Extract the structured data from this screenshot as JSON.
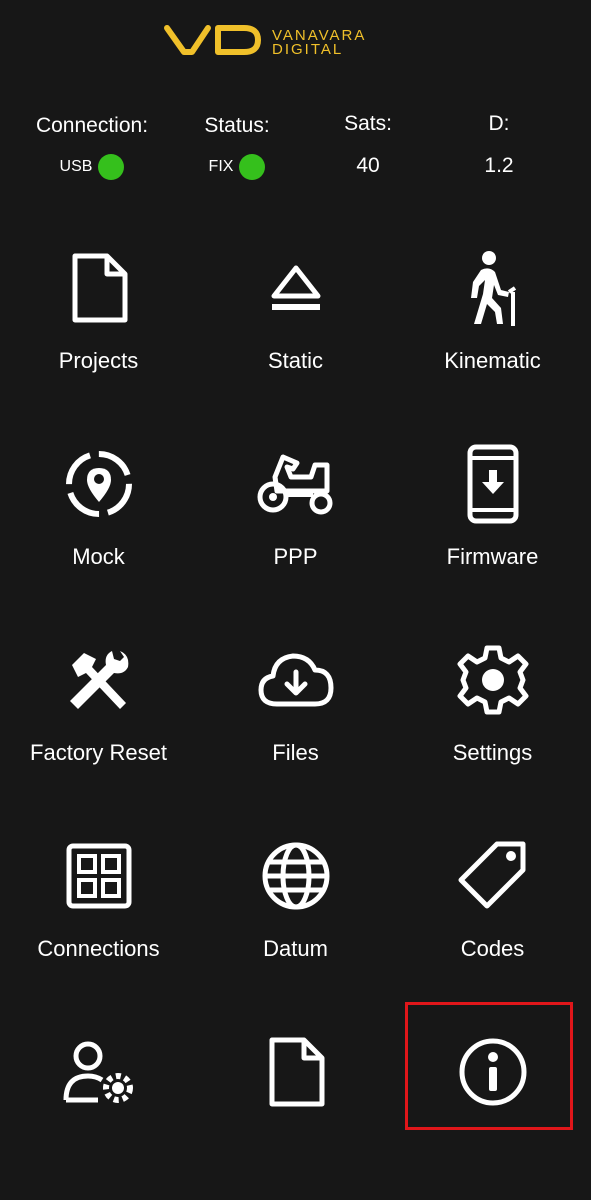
{
  "brand": {
    "line1": "VANAVARA",
    "line2": "DIGITAL",
    "accent_color": "#f0c02a"
  },
  "status_bar": {
    "connection": {
      "label": "Connection:",
      "value": "USB",
      "indicator_color": "#35c01c"
    },
    "status": {
      "label": "Status:",
      "value": "FIX",
      "indicator_color": "#35c01c"
    },
    "sats": {
      "label": "Sats:",
      "value": "40"
    },
    "d": {
      "label": "D:",
      "value": "1.2"
    }
  },
  "menu": [
    {
      "label": "Projects",
      "icon": "document-icon"
    },
    {
      "label": "Static",
      "icon": "eject-icon"
    },
    {
      "label": "Kinematic",
      "icon": "walking-person-icon"
    },
    {
      "label": "Mock",
      "icon": "location-dashed-icon"
    },
    {
      "label": "PPP",
      "icon": "tractor-icon"
    },
    {
      "label": "Firmware",
      "icon": "phone-download-icon"
    },
    {
      "label": "Factory Reset",
      "icon": "tools-icon"
    },
    {
      "label": "Files",
      "icon": "cloud-download-icon"
    },
    {
      "label": "Settings",
      "icon": "gear-icon"
    },
    {
      "label": "Connections",
      "icon": "grid-icon"
    },
    {
      "label": "Datum",
      "icon": "globe-icon"
    },
    {
      "label": "Codes",
      "icon": "tag-icon"
    },
    {
      "label": "",
      "icon": "user-settings-icon"
    },
    {
      "label": "",
      "icon": "document-icon"
    },
    {
      "label": "",
      "icon": "info-icon"
    }
  ],
  "highlight_color": "#e0161a"
}
